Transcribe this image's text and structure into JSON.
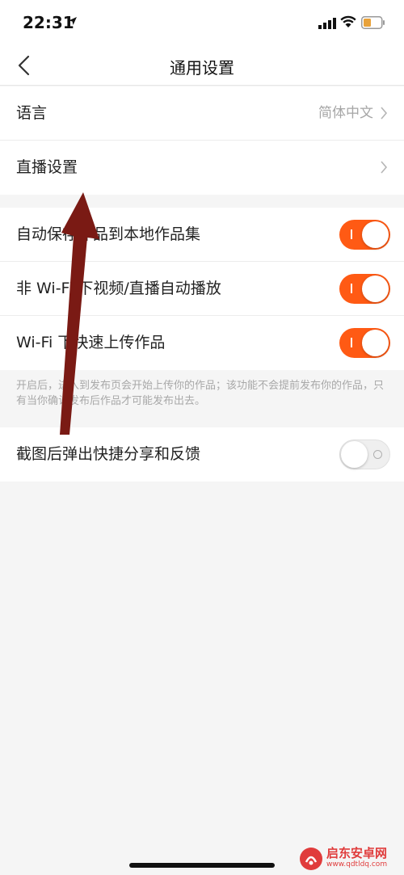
{
  "status_bar": {
    "time": "22:31",
    "icons": [
      "location-arrow-icon",
      "signal-icon",
      "wifi-icon",
      "battery-icon"
    ],
    "battery_color": "#e8a23a"
  },
  "nav": {
    "title": "通用设置",
    "back_icon": "chevron-left-icon"
  },
  "group1": {
    "language": {
      "label": "语言",
      "value": "简体中文"
    },
    "live_settings": {
      "label": "直播设置"
    }
  },
  "group2": {
    "items": [
      {
        "label": "自动保存作品到本地作品集",
        "on": true
      },
      {
        "label": "非 Wi-Fi 下视频/直播自动播放",
        "on": true
      },
      {
        "label": "Wi-Fi 下快速上传作品",
        "on": true
      }
    ],
    "note": "开启后，进入到发布页会开始上传你的作品；该功能不会提前发布你的作品，只有当你确认发布后作品才可能发布出去。"
  },
  "group3": {
    "items": [
      {
        "label": "截图后弹出快捷分享和反馈",
        "on": false
      }
    ]
  },
  "watermark": {
    "name": "启东安卓网",
    "url": "www.qdtldq.com"
  },
  "colors": {
    "accent": "#ff5a14",
    "annotation_arrow": "#7a1a14"
  }
}
